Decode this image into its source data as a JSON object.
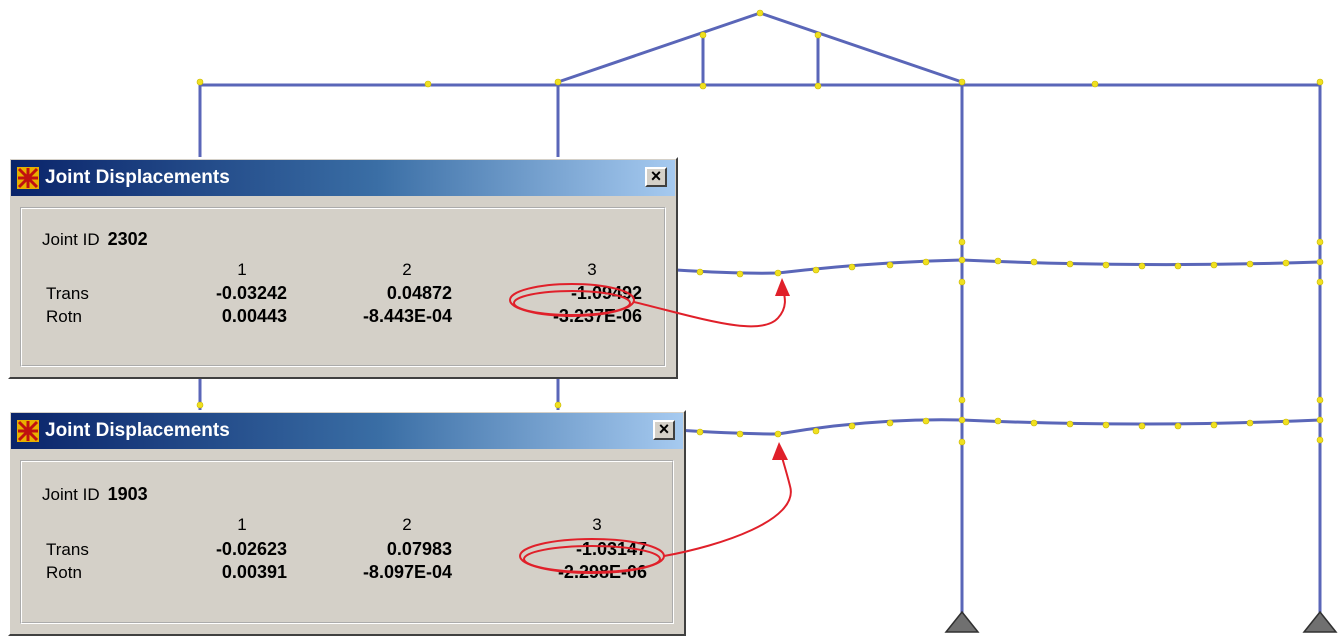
{
  "dialogs": [
    {
      "title": "Joint Displacements",
      "close_glyph": "×",
      "joint_id_label": "Joint ID",
      "joint_id": "2302",
      "columns": [
        "1",
        "2",
        "3"
      ],
      "rows": [
        {
          "label": "Trans",
          "values": [
            "-0.03242",
            "0.04872",
            "-1.09492"
          ]
        },
        {
          "label": "Rotn",
          "values": [
            "0.00443",
            "-8.443E-04",
            "-3.237E-06"
          ]
        }
      ]
    },
    {
      "title": "Joint Displacements",
      "close_glyph": "×",
      "joint_id_label": "Joint ID",
      "joint_id": "1903",
      "columns": [
        "1",
        "2",
        "3"
      ],
      "rows": [
        {
          "label": "Trans",
          "values": [
            "-0.02623",
            "0.07983",
            "-1.03147"
          ]
        },
        {
          "label": "Rotn",
          "values": [
            "0.00391",
            "-8.097E-04",
            "-2.298E-06"
          ]
        }
      ]
    }
  ],
  "colors": {
    "member": "#5a66b8",
    "joint": "#f0e020",
    "callout": "#e0202a",
    "support": "#707070"
  },
  "icons": [
    "app-icon",
    "close-icon",
    "pinned-support-icon"
  ]
}
